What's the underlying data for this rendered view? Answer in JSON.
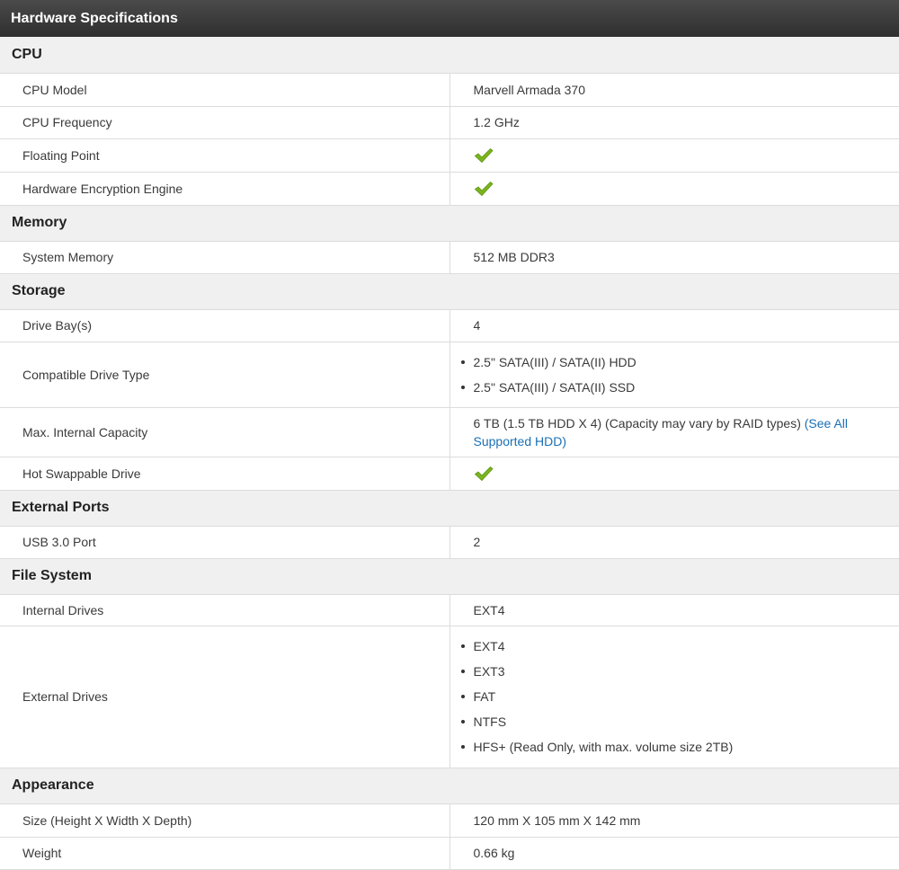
{
  "header": {
    "title": "Hardware Specifications"
  },
  "sections": {
    "cpu": {
      "title": "CPU",
      "model": {
        "label": "CPU Model",
        "value": "Marvell Armada 370"
      },
      "frequency": {
        "label": "CPU Frequency",
        "value": "1.2 GHz"
      },
      "floating_point": {
        "label": "Floating Point",
        "icon": "checkmark-icon"
      },
      "encryption": {
        "label": "Hardware Encryption Engine",
        "icon": "checkmark-icon"
      }
    },
    "memory": {
      "title": "Memory",
      "system_memory": {
        "label": "System Memory",
        "value": "512 MB DDR3"
      }
    },
    "storage": {
      "title": "Storage",
      "drive_bays": {
        "label": "Drive Bay(s)",
        "value": "4"
      },
      "drive_type": {
        "label": "Compatible Drive Type",
        "items": [
          "2.5\" SATA(III) / SATA(II) HDD",
          "2.5\" SATA(III) / SATA(II) SSD"
        ]
      },
      "max_capacity": {
        "label": "Max. Internal Capacity",
        "text": "6 TB (1.5 TB HDD X 4) (Capacity may vary by RAID types) ",
        "link_text": "(See All Supported HDD)"
      },
      "hot_swap": {
        "label": "Hot Swappable Drive",
        "icon": "checkmark-icon"
      }
    },
    "external_ports": {
      "title": "External Ports",
      "usb3": {
        "label": "USB 3.0 Port",
        "value": "2"
      }
    },
    "file_system": {
      "title": "File System",
      "internal": {
        "label": "Internal Drives",
        "value": "EXT4"
      },
      "external": {
        "label": "External Drives",
        "items": [
          "EXT4",
          "EXT3",
          "FAT",
          "NTFS",
          "HFS+ (Read Only, with max. volume size 2TB)"
        ]
      }
    },
    "appearance": {
      "title": "Appearance",
      "size": {
        "label": "Size (Height X Width X Depth)",
        "value": "120 mm X 105 mm X 142 mm"
      },
      "weight": {
        "label": "Weight",
        "value": "0.66 kg"
      }
    }
  },
  "colors": {
    "header_bg": "#3a3a3a",
    "section_bg": "#f0f0f0",
    "check_green": "#7ab51d",
    "link": "#1a6fb5",
    "border": "#dcdcdc"
  }
}
